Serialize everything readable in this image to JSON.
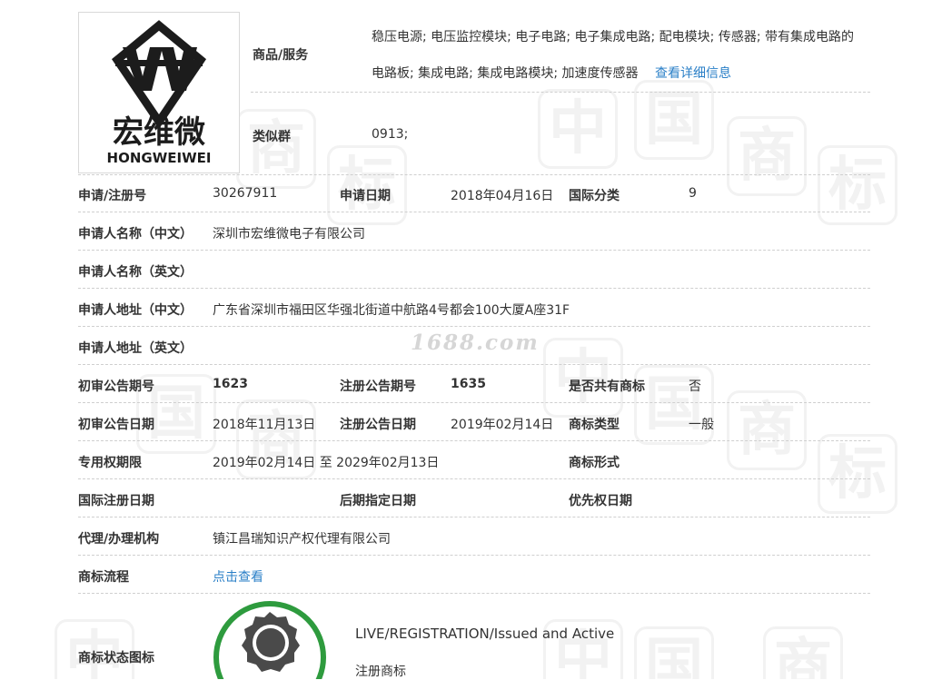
{
  "top": {
    "goods_label": "商品/服务",
    "goods_line1": "稳压电源; 电压监控模块; 电子电路; 电子集成电路; 配电模块; 传感器; 带有集成电路的",
    "goods_line2": "电路板; 集成电路; 集成电路模块; 加速度传感器",
    "goods_link": "查看详细信息",
    "similar_label": "类似群",
    "similar_value": "0913;"
  },
  "logo": {
    "cn": "宏维微",
    "en": "HONGWEIWEI"
  },
  "fields": {
    "reg_no_label": "申请/注册号",
    "reg_no": "30267911",
    "app_date_label": "申请日期",
    "app_date": "2018年04月16日",
    "intl_class_label": "国际分类",
    "intl_class": "9",
    "applicant_cn_label": "申请人名称（中文）",
    "applicant_cn": "深圳市宏维微电子有限公司",
    "applicant_en_label": "申请人名称（英文）",
    "address_cn_label": "申请人地址（中文）",
    "address_cn": "广东省深圳市福田区华强北街道中航路4号都会100大厦A座31F",
    "address_en_label": "申请人地址（英文）",
    "prelim_issue_label": "初审公告期号",
    "prelim_issue": "1623",
    "reg_issue_label": "注册公告期号",
    "reg_issue": "1635",
    "shared_label": "是否共有商标",
    "shared": "否",
    "prelim_date_label": "初审公告日期",
    "prelim_date": "2018年11月13日",
    "reg_date_label": "注册公告日期",
    "reg_date": "2019年02月14日",
    "tm_type_label": "商标类型",
    "tm_type": "一般",
    "exclusive_label": "专用权期限",
    "exclusive": "2019年02月14日 至 2029年02月13日",
    "tm_form_label": "商标形式",
    "intl_reg_date_label": "国际注册日期",
    "later_date_label": "后期指定日期",
    "priority_date_label": "优先权日期",
    "agent_label": "代理/办理机构",
    "agent": "镇江昌瑞知识产权代理有限公司",
    "flow_label": "商标流程",
    "flow_link": "点击查看",
    "status_icon_label": "商标状态图标",
    "status_en": "LIVE/REGISTRATION/Issued and Active",
    "status_cn": "注册商标"
  },
  "watermark": {
    "site": "1688.com",
    "glyphs": [
      "中",
      "国",
      "商",
      "标"
    ]
  },
  "colors": {
    "link": "#2a7fc7",
    "status_ring": "#2e9b3e",
    "badge": "#4a4a4a"
  }
}
